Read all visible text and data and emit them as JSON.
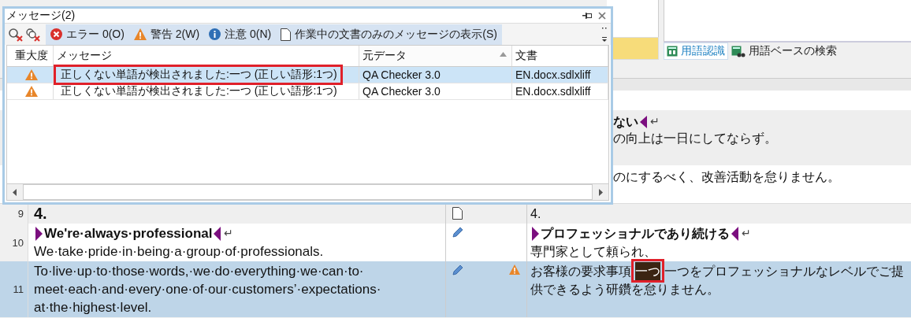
{
  "message_window": {
    "title": "メッセージ(2)",
    "filters": [
      {
        "kind": "error",
        "label": "エラー 0(O)",
        "selected": true
      },
      {
        "kind": "warning",
        "label": "警告 2(W)",
        "selected": true
      },
      {
        "kind": "info",
        "label": "注意 0(N)",
        "selected": true
      },
      {
        "kind": "document",
        "label": "作業中の文書のみのメッセージの表示(S)",
        "selected": true
      }
    ],
    "columns": [
      {
        "label": "重大度",
        "sorted": false
      },
      {
        "label": "メッセージ",
        "sorted": false
      },
      {
        "label": "元データ",
        "sorted": true
      },
      {
        "label": "文書",
        "sorted": false
      }
    ],
    "rows": [
      {
        "kind": "warning",
        "message": "正しくない単語が検出されました:一つ (正しい語形:1つ)",
        "source": "QA Checker 3.0",
        "document": "EN.docx.sdlxliff",
        "selected": true,
        "flagged": true
      },
      {
        "kind": "warning",
        "message": "正しくない単語が検出されました:一つ (正しい語形:1つ)",
        "source": "QA Checker 3.0",
        "document": "EN.docx.sdlxliff",
        "selected": false,
        "flagged": false
      }
    ]
  },
  "term_tabs": [
    {
      "kind": "recognition",
      "label": "用語認識",
      "selected": true
    },
    {
      "kind": "search",
      "label": "用語ベースの検索",
      "selected": false
    }
  ],
  "background_segments": [
    {
      "shaded": true,
      "lines": [
        {
          "kind": "heading",
          "text": "ない",
          "open_tag": false,
          "close_tag": true,
          "break": "↵"
        },
        {
          "kind": "plain",
          "text": "の向上は一日にしてならず。"
        }
      ]
    },
    {
      "shaded": false,
      "lines": [
        {
          "kind": "plain",
          "text": "のにするべく、改善活動を怠りません。"
        }
      ]
    }
  ],
  "segments": [
    {
      "number": "9",
      "kind": "document",
      "warning": false,
      "selected": false,
      "source": [
        {
          "kind": "title",
          "text": "4."
        }
      ],
      "target": [
        {
          "kind": "plain",
          "text": "4."
        }
      ]
    },
    {
      "number": "10",
      "kind": "edited",
      "warning": false,
      "selected": false,
      "source": [
        {
          "kind": "heading",
          "text": "We're·always·professional",
          "open_tag": true,
          "close_tag": true,
          "break": "↵"
        },
        {
          "kind": "plain",
          "text": "We·take·pride·in·being·a·group·of·professionals."
        }
      ],
      "target": [
        {
          "kind": "heading",
          "text": "プロフェッショナルであり続ける",
          "open_tag": true,
          "close_tag": true,
          "break": "↵"
        },
        {
          "kind": "plain",
          "text": "専門家として頼られ、"
        }
      ]
    },
    {
      "number": "11",
      "kind": "edited",
      "warning": true,
      "selected": true,
      "source": [
        {
          "kind": "plain",
          "text": "To·live·up·to·those·words,·we·do·everything·we·can·to·"
        },
        {
          "kind": "plain",
          "text": "meet·each·and·every·one·of·our·customers’·expectations·"
        },
        {
          "kind": "plain",
          "text": "at·the·highest·level."
        }
      ],
      "target": [
        {
          "kind": "marked",
          "parts": [
            {
              "text": "お客様の要求事項",
              "marked": false,
              "flagged": false
            },
            {
              "text": "一つ",
              "marked": true,
              "flagged": true
            },
            {
              "text": "一つをプロフェッショナルなレベルでご提",
              "marked": false,
              "flagged": false
            }
          ]
        },
        {
          "kind": "plain",
          "text": "供できるよう研鑽を怠りません。"
        }
      ]
    }
  ]
}
